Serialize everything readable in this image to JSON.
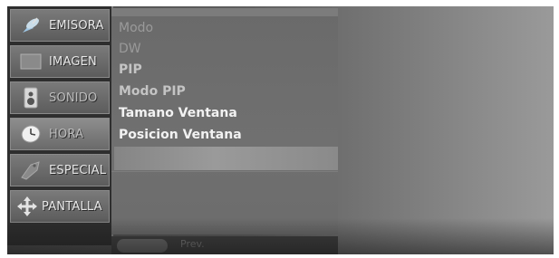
{
  "sidebar": {
    "items": [
      {
        "label": "EMISORA",
        "icon": "satellite-icon"
      },
      {
        "label": "IMAGEN",
        "icon": "picture-icon"
      },
      {
        "label": "SONIDO",
        "icon": "speaker-icon"
      },
      {
        "label": "HORA",
        "icon": "clock-icon"
      },
      {
        "label": "ESPECIAL",
        "icon": "tag-icon"
      },
      {
        "label": "PANTALLA",
        "icon": "move-arrows-icon"
      }
    ],
    "active_index": 3
  },
  "menu": {
    "items": [
      {
        "label": "Modo",
        "state": "dim"
      },
      {
        "label": "DW",
        "state": "dim"
      },
      {
        "label": "PIP",
        "state": "mid"
      },
      {
        "label": "Modo PIP",
        "state": "mid"
      },
      {
        "label": "Tamano Ventana",
        "state": "bright"
      },
      {
        "label": "Posicion Ventana",
        "state": "bright"
      }
    ]
  },
  "footer": {
    "prev_label": "Prev."
  },
  "colors": {
    "menu_bg": "#6a6a6a",
    "sidebar_item": "#6a6a6a",
    "text_bright": "#f2f2f2"
  }
}
